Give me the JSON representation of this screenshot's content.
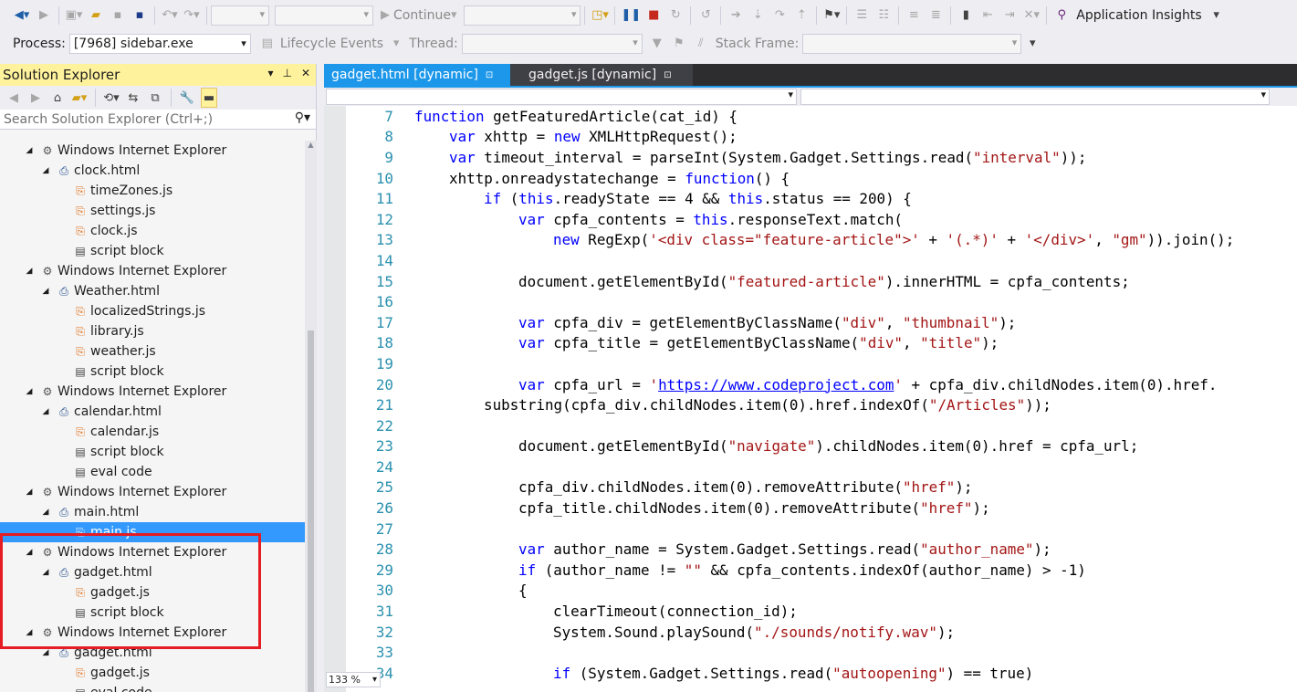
{
  "toolbar1": {
    "continue_label": "Continue",
    "app_insights_label": "Application Insights"
  },
  "toolbar2": {
    "process_label": "Process:",
    "process_value": "[7968] sidebar.exe",
    "lifecycle_label": "Lifecycle Events",
    "thread_label": "Thread:",
    "stack_frame_label": "Stack Frame:"
  },
  "solution_explorer": {
    "title": "Solution Explorer",
    "search_placeholder": "Search Solution Explorer (Ctrl+;)",
    "tree": [
      {
        "label": "Windows Internet Explorer",
        "kind": "process",
        "level": 0
      },
      {
        "label": "clock.html",
        "kind": "html",
        "level": 1
      },
      {
        "label": "timeZones.js",
        "kind": "js",
        "level": 2
      },
      {
        "label": "settings.js",
        "kind": "js",
        "level": 2
      },
      {
        "label": "clock.js",
        "kind": "js",
        "level": 2
      },
      {
        "label": "script block",
        "kind": "block",
        "level": 2
      },
      {
        "label": "Windows Internet Explorer",
        "kind": "process",
        "level": 0
      },
      {
        "label": "Weather.html",
        "kind": "html",
        "level": 1
      },
      {
        "label": "localizedStrings.js",
        "kind": "js",
        "level": 2
      },
      {
        "label": "library.js",
        "kind": "js",
        "level": 2
      },
      {
        "label": "weather.js",
        "kind": "js",
        "level": 2
      },
      {
        "label": "script block",
        "kind": "block",
        "level": 2
      },
      {
        "label": "Windows Internet Explorer",
        "kind": "process",
        "level": 0
      },
      {
        "label": "calendar.html",
        "kind": "html",
        "level": 1
      },
      {
        "label": "calendar.js",
        "kind": "js",
        "level": 2
      },
      {
        "label": "script block",
        "kind": "block",
        "level": 2
      },
      {
        "label": "eval code",
        "kind": "block",
        "level": 2
      },
      {
        "label": "Windows Internet Explorer",
        "kind": "process",
        "level": 0
      },
      {
        "label": "main.html",
        "kind": "html",
        "level": 1
      },
      {
        "label": "main.js",
        "kind": "js",
        "level": 2,
        "selected": true
      },
      {
        "label": "Windows Internet Explorer",
        "kind": "process",
        "level": 0
      },
      {
        "label": "gadget.html",
        "kind": "html",
        "level": 1
      },
      {
        "label": "gadget.js",
        "kind": "js",
        "level": 2
      },
      {
        "label": "script block",
        "kind": "block",
        "level": 2
      },
      {
        "label": "Windows Internet Explorer",
        "kind": "process",
        "level": 0
      },
      {
        "label": "gadget.html",
        "kind": "html",
        "level": 1
      },
      {
        "label": "gadget.js",
        "kind": "js",
        "level": 2
      },
      {
        "label": "eval code",
        "kind": "block",
        "level": 2
      }
    ]
  },
  "editor": {
    "tabs": [
      {
        "label": "gadget.html [dynamic]",
        "active": true
      },
      {
        "label": "gadget.js [dynamic]",
        "active": false
      }
    ],
    "zoom": "133 %",
    "lines": [
      {
        "n": "7",
        "indent": 0,
        "tokens": [
          [
            "kw",
            "function"
          ],
          [
            "t",
            " getFeaturedArticle(cat_id) {"
          ]
        ]
      },
      {
        "n": "8",
        "indent": 1,
        "tokens": [
          [
            "kw",
            "var"
          ],
          [
            "t",
            " xhttp = "
          ],
          [
            "kw",
            "new"
          ],
          [
            "t",
            " XMLHttpRequest();"
          ]
        ]
      },
      {
        "n": "9",
        "indent": 1,
        "tokens": [
          [
            "kw",
            "var"
          ],
          [
            "t",
            " timeout_interval = parseInt(System.Gadget.Settings.read("
          ],
          [
            "str",
            "\"interval\""
          ],
          [
            "t",
            "));"
          ]
        ]
      },
      {
        "n": "10",
        "indent": 1,
        "tokens": [
          [
            "t",
            "xhttp.onreadystatechange = "
          ],
          [
            "kw",
            "function"
          ],
          [
            "t",
            "() {"
          ]
        ]
      },
      {
        "n": "11",
        "indent": 2,
        "tokens": [
          [
            "kw",
            "if"
          ],
          [
            "t",
            " ("
          ],
          [
            "kw",
            "this"
          ],
          [
            "t",
            ".readyState == 4 && "
          ],
          [
            "kw",
            "this"
          ],
          [
            "t",
            ".status == 200) {"
          ]
        ]
      },
      {
        "n": "12",
        "indent": 3,
        "tokens": [
          [
            "kw",
            "var"
          ],
          [
            "t",
            " cpfa_contents = "
          ],
          [
            "kw",
            "this"
          ],
          [
            "t",
            ".responseText.match("
          ]
        ]
      },
      {
        "n": "13",
        "indent": 4,
        "tokens": [
          [
            "kw",
            "new"
          ],
          [
            "t",
            " RegExp("
          ],
          [
            "str",
            "'<div class=\"feature-article\">'"
          ],
          [
            "t",
            " + "
          ],
          [
            "str",
            "'(.*)'"
          ],
          [
            "t",
            " + "
          ],
          [
            "str",
            "'</div>'"
          ],
          [
            "t",
            ", "
          ],
          [
            "str",
            "\"gm\""
          ],
          [
            "t",
            ")).join();"
          ]
        ]
      },
      {
        "n": "14",
        "indent": 0,
        "tokens": []
      },
      {
        "n": "15",
        "indent": 3,
        "tokens": [
          [
            "t",
            "document.getElementById("
          ],
          [
            "str",
            "\"featured-article\""
          ],
          [
            "t",
            ").innerHTML = cpfa_contents;"
          ]
        ]
      },
      {
        "n": "16",
        "indent": 0,
        "tokens": []
      },
      {
        "n": "17",
        "indent": 3,
        "tokens": [
          [
            "kw",
            "var"
          ],
          [
            "t",
            " cpfa_div = getElementByClassName("
          ],
          [
            "str",
            "\"div\""
          ],
          [
            "t",
            ", "
          ],
          [
            "str",
            "\"thumbnail\""
          ],
          [
            "t",
            ");"
          ]
        ]
      },
      {
        "n": "18",
        "indent": 3,
        "tokens": [
          [
            "kw",
            "var"
          ],
          [
            "t",
            " cpfa_title = getElementByClassName("
          ],
          [
            "str",
            "\"div\""
          ],
          [
            "t",
            ", "
          ],
          [
            "str",
            "\"title\""
          ],
          [
            "t",
            ");"
          ]
        ]
      },
      {
        "n": "19",
        "indent": 0,
        "tokens": []
      },
      {
        "n": "20",
        "indent": 3,
        "tokens": [
          [
            "kw",
            "var"
          ],
          [
            "t",
            " cpfa_url = "
          ],
          [
            "str",
            "'"
          ],
          [
            "url",
            "https://www.codeproject.com"
          ],
          [
            "str",
            "'"
          ],
          [
            "t",
            " + cpfa_div.childNodes.item(0).href."
          ]
        ]
      },
      {
        "n": "21",
        "indent": 2,
        "tokens": [
          [
            "t",
            "substring(cpfa_div.childNodes.item(0).href.indexOf("
          ],
          [
            "str",
            "\"/Articles\""
          ],
          [
            "t",
            "));"
          ]
        ]
      },
      {
        "n": "22",
        "indent": 0,
        "tokens": []
      },
      {
        "n": "23",
        "indent": 3,
        "tokens": [
          [
            "t",
            "document.getElementById("
          ],
          [
            "str",
            "\"navigate\""
          ],
          [
            "t",
            ").childNodes.item(0).href = cpfa_url;"
          ]
        ]
      },
      {
        "n": "24",
        "indent": 0,
        "tokens": []
      },
      {
        "n": "25",
        "indent": 3,
        "tokens": [
          [
            "t",
            "cpfa_div.childNodes.item(0).removeAttribute("
          ],
          [
            "str",
            "\"href\""
          ],
          [
            "t",
            ");"
          ]
        ]
      },
      {
        "n": "26",
        "indent": 3,
        "tokens": [
          [
            "t",
            "cpfa_title.childNodes.item(0).removeAttribute("
          ],
          [
            "str",
            "\"href\""
          ],
          [
            "t",
            ");"
          ]
        ]
      },
      {
        "n": "27",
        "indent": 0,
        "tokens": []
      },
      {
        "n": "28",
        "indent": 3,
        "tokens": [
          [
            "kw",
            "var"
          ],
          [
            "t",
            " author_name = System.Gadget.Settings.read("
          ],
          [
            "str",
            "\"author_name\""
          ],
          [
            "t",
            ");"
          ]
        ]
      },
      {
        "n": "29",
        "indent": 3,
        "tokens": [
          [
            "kw",
            "if"
          ],
          [
            "t",
            " (author_name != "
          ],
          [
            "str",
            "\"\""
          ],
          [
            "t",
            " && cpfa_contents.indexOf(author_name) > -1)"
          ]
        ]
      },
      {
        "n": "30",
        "indent": 3,
        "tokens": [
          [
            "t",
            "{"
          ]
        ]
      },
      {
        "n": "31",
        "indent": 4,
        "tokens": [
          [
            "t",
            "clearTimeout(connection_id);"
          ]
        ]
      },
      {
        "n": "32",
        "indent": 4,
        "tokens": [
          [
            "t",
            "System.Sound.playSound("
          ],
          [
            "str",
            "\"./sounds/notify.wav\""
          ],
          [
            "t",
            ");"
          ]
        ]
      },
      {
        "n": "33",
        "indent": 0,
        "tokens": []
      },
      {
        "n": "34",
        "indent": 4,
        "tokens": [
          [
            "kw",
            "if"
          ],
          [
            "t",
            " (System.Gadget.Settings.read("
          ],
          [
            "str",
            "\"autoopening\""
          ],
          [
            "t",
            ") == true)"
          ]
        ]
      }
    ]
  }
}
